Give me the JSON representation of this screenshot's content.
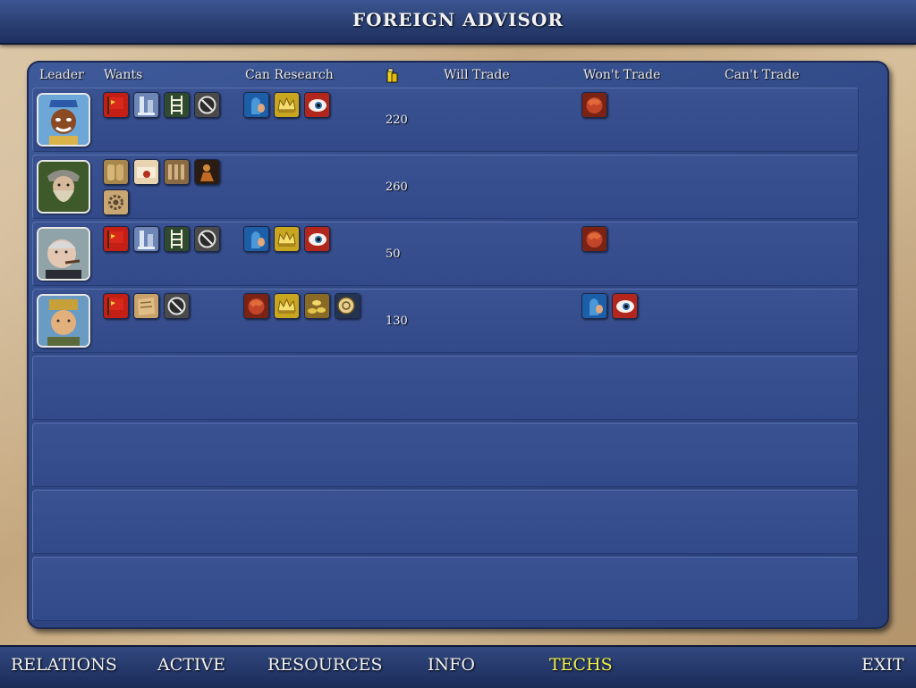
{
  "title": "FOREIGN ADVISOR",
  "columns": {
    "leader": "Leader",
    "wants": "Wants",
    "can_research": "Can Research",
    "gold": "gold-icon",
    "will_trade": "Will Trade",
    "wont_trade": "Won't Trade",
    "cant_trade": "Can't Trade"
  },
  "rows": [
    {
      "leader": "leader-egypt",
      "wants": [
        "red-flag-icon",
        "column-statue-icon",
        "ladder-icon",
        "compass-icon"
      ],
      "can_research": [
        "blue-hand-icon",
        "crown-icon",
        "eye-icon"
      ],
      "gold": "220",
      "will_trade": [],
      "wont_trade": [
        "red-beast-icon"
      ]
    },
    {
      "leader": "leader-viking",
      "wants": [
        "tablets-icon",
        "scroll-icon",
        "pillars-icon",
        "dark-figure-icon",
        "gear-map-icon"
      ],
      "can_research": [],
      "gold": "260",
      "will_trade": [],
      "wont_trade": []
    },
    {
      "leader": "leader-britain",
      "wants": [
        "red-flag-icon",
        "column-statue-icon",
        "ladder-icon",
        "compass-icon"
      ],
      "can_research": [
        "blue-hand-icon",
        "crown-icon",
        "eye-icon"
      ],
      "gold": "50",
      "will_trade": [],
      "wont_trade": [
        "red-beast-icon"
      ]
    },
    {
      "leader": "leader-asia",
      "wants": [
        "red-flag-icon",
        "scroll-map-icon",
        "compass-icon"
      ],
      "can_research": [
        "red-beast-icon",
        "crown-icon",
        "coins-icon",
        "astrolabe-icon"
      ],
      "gold": "130",
      "will_trade": [],
      "wont_trade": [
        "blue-hand-icon",
        "eye-icon"
      ]
    },
    {
      "leader": "",
      "wants": [],
      "can_research": [],
      "gold": "",
      "will_trade": [],
      "wont_trade": []
    },
    {
      "leader": "",
      "wants": [],
      "can_research": [],
      "gold": "",
      "will_trade": [],
      "wont_trade": []
    },
    {
      "leader": "",
      "wants": [],
      "can_research": [],
      "gold": "",
      "will_trade": [],
      "wont_trade": []
    },
    {
      "leader": "",
      "wants": [],
      "can_research": [],
      "gold": "",
      "will_trade": [],
      "wont_trade": []
    }
  ],
  "nav": {
    "relations": "RELATIONS",
    "active": "ACTIVE",
    "resources": "RESOURCES",
    "info": "INFO",
    "techs": "TECHS",
    "exit": "EXIT",
    "selected": "techs"
  },
  "colors": {
    "panel": "#2f4785",
    "title_bar": "#2a3f72",
    "active_nav": "#f1f14a"
  }
}
